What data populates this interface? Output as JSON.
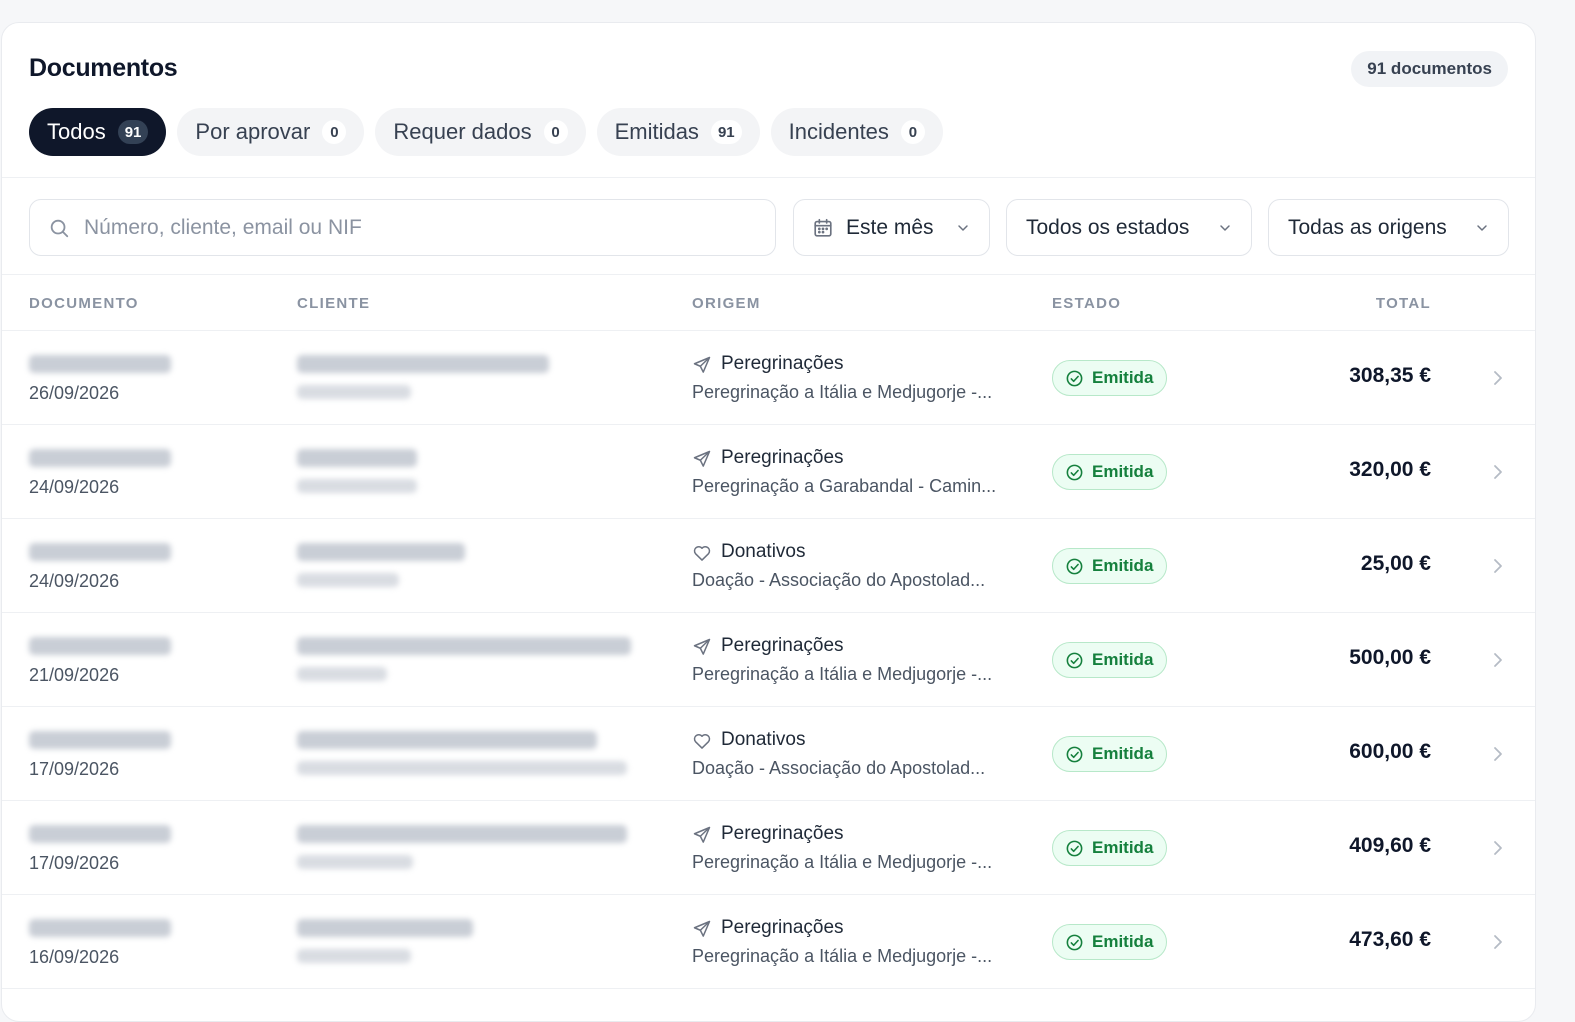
{
  "header": {
    "title": "Documentos",
    "count_label": "91 documentos"
  },
  "tabs": [
    {
      "label": "Todos",
      "badge": "91",
      "active": true
    },
    {
      "label": "Por aprovar",
      "badge": "0",
      "active": false
    },
    {
      "label": "Requer dados",
      "badge": "0",
      "active": false
    },
    {
      "label": "Emitidas",
      "badge": "91",
      "active": false
    },
    {
      "label": "Incidentes",
      "badge": "0",
      "active": false
    }
  ],
  "filters": {
    "search_placeholder": "Número, cliente, email ou NIF",
    "search_icon": "search-icon",
    "period": "Este mês",
    "period_icon": "calendar-icon",
    "status": "Todos os estados",
    "origin": "Todas as origens"
  },
  "columns": {
    "document": "DOCUMENTO",
    "client": "CLIENTE",
    "origin": "ORIGEM",
    "status": "ESTADO",
    "total": "TOTAL"
  },
  "colors": {
    "primary": "#0f172a",
    "success_text": "#15803d",
    "success_bg": "#ecfdf3",
    "muted": "#8a93a2"
  },
  "rows": [
    {
      "date": "26/09/2026",
      "origin": "Peregrinações",
      "origin_icon": "plane-icon",
      "description": "Peregrinação a Itália e Medjugorje -...",
      "status": "Emitida",
      "total": "308,35 €"
    },
    {
      "date": "24/09/2026",
      "origin": "Peregrinações",
      "origin_icon": "plane-icon",
      "description": "Peregrinação a Garabandal - Camin...",
      "status": "Emitida",
      "total": "320,00 €"
    },
    {
      "date": "24/09/2026",
      "origin": "Donativos",
      "origin_icon": "heart-icon",
      "description": "Doação - Associação do Apostolad...",
      "status": "Emitida",
      "total": "25,00 €"
    },
    {
      "date": "21/09/2026",
      "origin": "Peregrinações",
      "origin_icon": "plane-icon",
      "description": "Peregrinação a Itália e Medjugorje -...",
      "status": "Emitida",
      "total": "500,00 €"
    },
    {
      "date": "17/09/2026",
      "origin": "Donativos",
      "origin_icon": "heart-icon",
      "description": "Doação - Associação do Apostolad...",
      "status": "Emitida",
      "total": "600,00 €"
    },
    {
      "date": "17/09/2026",
      "origin": "Peregrinações",
      "origin_icon": "plane-icon",
      "description": "Peregrinação a Itália e Medjugorje -...",
      "status": "Emitida",
      "total": "409,60 €"
    },
    {
      "date": "16/09/2026",
      "origin": "Peregrinações",
      "origin_icon": "plane-icon",
      "description": "Peregrinação a Itália e Medjugorje -...",
      "status": "Emitida",
      "total": "473,60 €"
    }
  ]
}
